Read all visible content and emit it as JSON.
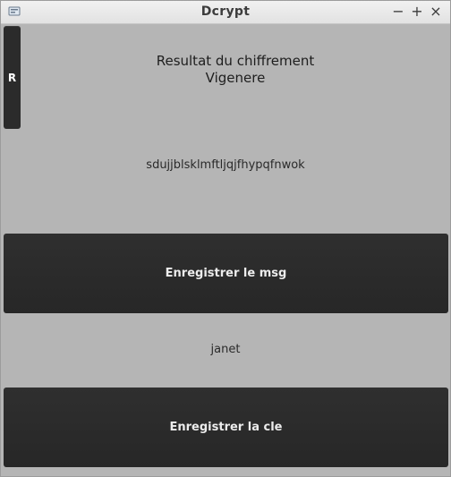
{
  "window": {
    "title": "Dcrypt",
    "controls": {
      "minimize": "−",
      "maximize": "+",
      "close": "×"
    }
  },
  "main": {
    "side_button_label": "R",
    "result_title_line1": "Resultat du chiffrement",
    "result_title_line2": "Vigenere",
    "cipher_text": "sdujjblsklmftljqjfhypqfnwok",
    "save_message_label": "Enregistrer le msg",
    "key_text": "janet",
    "save_key_label": "Enregistrer la cle"
  },
  "colors": {
    "background": "#b5b5b5",
    "button": "#2b2b2b",
    "button_text": "#ececec",
    "titlebar": "#e8e8e8"
  }
}
